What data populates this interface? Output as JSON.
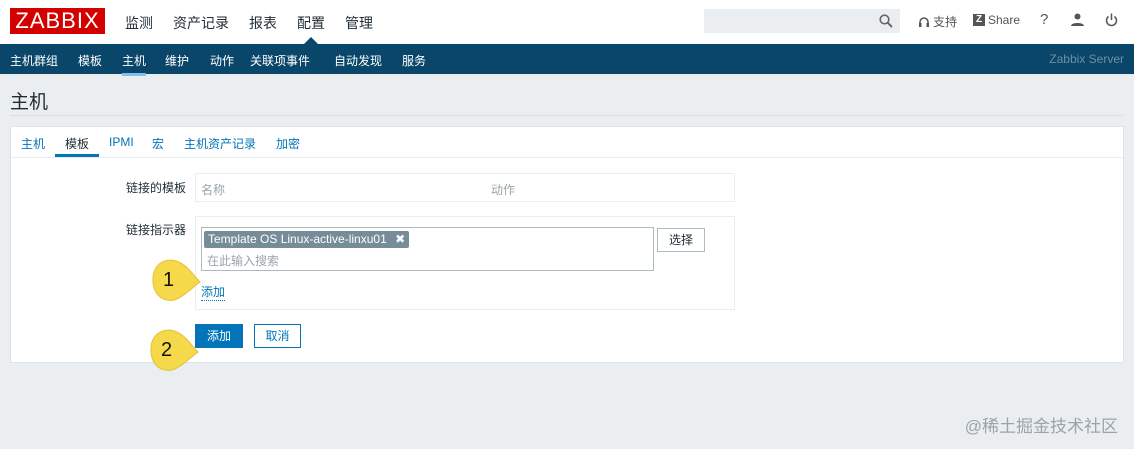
{
  "header": {
    "logo": "ZABBIX",
    "nav": [
      "监测",
      "资产记录",
      "报表",
      "配置",
      "管理"
    ],
    "support": "支持",
    "share": "Share",
    "help": "?"
  },
  "subnav": {
    "items": [
      "主机群组",
      "模板",
      "主机",
      "维护",
      "动作",
      "关联项事件",
      "自动发现",
      "服务"
    ],
    "active": "主机",
    "server": "Zabbix Server"
  },
  "page": {
    "title": "主机"
  },
  "tabs": [
    "主机",
    "模板",
    "IPMI",
    "宏",
    "主机资产记录",
    "加密"
  ],
  "form": {
    "linked_label": "链接的模板",
    "col_name": "名称",
    "col_action": "动作",
    "link_label": "链接指示器",
    "tag": "Template OS Linux-active-linxu01",
    "placeholder": "在此输入搜索",
    "select": "选择",
    "add_link": "添加",
    "submit": "添加",
    "cancel": "取消"
  },
  "callouts": [
    "1",
    "2"
  ],
  "watermark": "@稀土掘金技术社区",
  "colors": {
    "brand": "#d40000",
    "nav": "#0a466a",
    "accent": "#0275b8",
    "callout": "#f5d94a"
  }
}
